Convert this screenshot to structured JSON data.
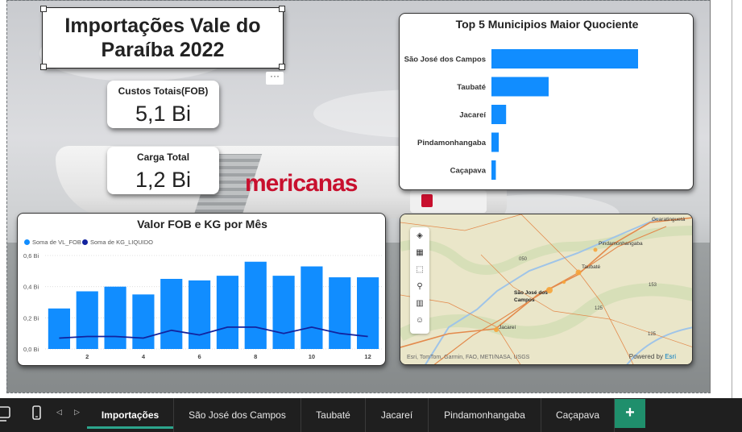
{
  "report_title": "Importações Vale do Paraíba 2022",
  "kpis": {
    "custos": {
      "label": "Custos Totais(FOB)",
      "value": "5,1 Bi"
    },
    "carga": {
      "label": "Carga Total",
      "value": "1,2 Bi"
    }
  },
  "background_text": "mericanas",
  "more_options_icon": "ellipsis-icon",
  "top5_chart": {
    "title": "Top 5 Municipios Maior Quociente",
    "color": "#118dff",
    "chart_data": {
      "type": "bar",
      "orientation": "horizontal",
      "categories": [
        "São José dos Campos",
        "Taubaté",
        "Jacareí",
        "Pindamonhangaba",
        "Caçapava"
      ],
      "values": [
        1.0,
        0.39,
        0.1,
        0.05,
        0.03
      ],
      "grid": false
    }
  },
  "fob_chart": {
    "title": "Valor FOB e KG por Mês",
    "legend": [
      {
        "name": "Soma de VL_FOB",
        "color": "#118dff"
      },
      {
        "name": "Soma de KG_LIQUIDO",
        "color": "#12239e"
      }
    ],
    "chart_data": {
      "type": "bar",
      "x": [
        1,
        2,
        3,
        4,
        5,
        6,
        7,
        8,
        9,
        10,
        11,
        12
      ],
      "x_tick_labels": [
        "2",
        "4",
        "6",
        "8",
        "10",
        "12"
      ],
      "y_tick_labels": [
        "0,0 Bi",
        "0,2 Bi",
        "0,4 Bi",
        "0,6 Bi"
      ],
      "ylim": [
        0,
        0.6
      ],
      "series": [
        {
          "name": "Soma de VL_FOB",
          "type": "bar",
          "values": [
            0.26,
            0.37,
            0.4,
            0.35,
            0.45,
            0.44,
            0.47,
            0.56,
            0.47,
            0.53,
            0.46,
            0.46
          ]
        },
        {
          "name": "Soma de KG_LIQUIDO",
          "type": "line",
          "values": [
            0.07,
            0.08,
            0.08,
            0.07,
            0.12,
            0.09,
            0.14,
            0.14,
            0.1,
            0.14,
            0.1,
            0.08
          ]
        }
      ],
      "grid": true,
      "legend_position": "top-left"
    }
  },
  "map": {
    "labels": {
      "guaratingueta": "Guaratinguetá",
      "pindamonhangaba": "Pindamonhangaba",
      "taubate": "Taubaté",
      "sjc_1": "São José dos",
      "sjc_2": "Campos",
      "jacarei": "Jacareí",
      "road_050": "050",
      "road_153": "153",
      "road_125a": "125",
      "road_125b": "125"
    },
    "attribution": "Esri, TomTom, Garmin, FAO, METI/NASA, USGS",
    "powered_by": "Powered by",
    "powered_brand": "Esri",
    "tools": [
      "layers-icon",
      "qr-select-icon",
      "rect-select-icon",
      "search-icon",
      "chart-icon",
      "person-icon"
    ],
    "colors": {
      "land": "#eae6c9",
      "road": "#e38a4c",
      "water": "#9fc4e8",
      "bubble": "#f6a43a"
    }
  },
  "tabs": [
    {
      "label": "Importações",
      "active": true
    },
    {
      "label": "São José dos Campos",
      "active": false
    },
    {
      "label": "Taubaté",
      "active": false
    },
    {
      "label": "Jacareí",
      "active": false
    },
    {
      "label": "Pindamonhangaba",
      "active": false
    },
    {
      "label": "Caçapava",
      "active": false
    }
  ],
  "add_tab_label": "+",
  "nav_icons": [
    "desktop-icon",
    "phone-icon",
    "chevron-left-icon",
    "chevron-right-icon"
  ]
}
